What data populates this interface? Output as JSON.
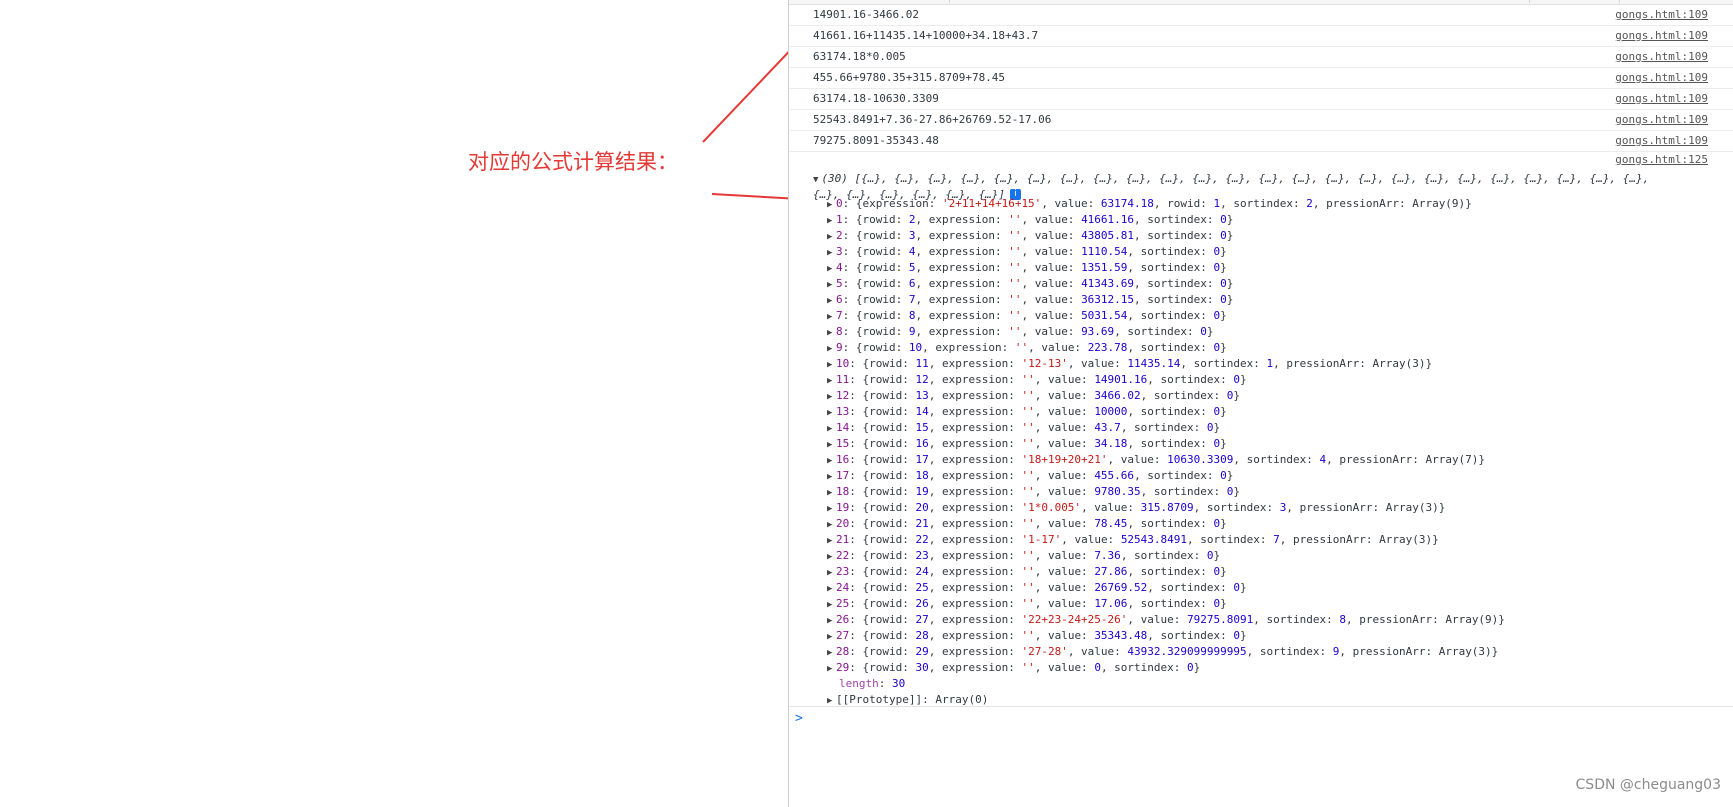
{
  "annotation": {
    "text": "对应的公式计算结果：",
    "color": "#e53935"
  },
  "log_lines": [
    {
      "text": "14901.16-3466.02",
      "source": "gongs.html:109"
    },
    {
      "text": "41661.16+11435.14+10000+34.18+43.7",
      "source": "gongs.html:109"
    },
    {
      "text": "63174.18*0.005",
      "source": "gongs.html:109"
    },
    {
      "text": "455.66+9780.35+315.8709+78.45",
      "source": "gongs.html:109"
    },
    {
      "text": "63174.18-10630.3309",
      "source": "gongs.html:109"
    },
    {
      "text": "52543.8491+7.36-27.86+26769.52-17.06",
      "source": "gongs.html:109"
    },
    {
      "text": "79275.8091-35343.48",
      "source": "gongs.html:109"
    }
  ],
  "group_source": "gongs.html:125",
  "array_header": "(30) [{…}, {…}, {…}, {…}, {…}, {…}, {…}, {…}, {…}, {…}, {…}, {…}, {…}, {…}, {…}, {…}, {…}, {…}, {…}, {…}, {…}, {…}, {…}, {…}, {…}, {…}, {…}, {…}, {…}, {…}]",
  "info_badge": "i",
  "entries": [
    {
      "index": "0",
      "text": "{expression: '2+11+14+16+15', value: 63174.18, rowid: 1, sortindex: 2, pressionArr: Array(9)}"
    },
    {
      "index": "1",
      "text": "{rowid: 2, expression: '', value: 41661.16, sortindex: 0}"
    },
    {
      "index": "2",
      "text": "{rowid: 3, expression: '', value: 43805.81, sortindex: 0}"
    },
    {
      "index": "3",
      "text": "{rowid: 4, expression: '', value: 1110.54, sortindex: 0}"
    },
    {
      "index": "4",
      "text": "{rowid: 5, expression: '', value: 1351.59, sortindex: 0}"
    },
    {
      "index": "5",
      "text": "{rowid: 6, expression: '', value: 41343.69, sortindex: 0}"
    },
    {
      "index": "6",
      "text": "{rowid: 7, expression: '', value: 36312.15, sortindex: 0}"
    },
    {
      "index": "7",
      "text": "{rowid: 8, expression: '', value: 5031.54, sortindex: 0}"
    },
    {
      "index": "8",
      "text": "{rowid: 9, expression: '', value: 93.69, sortindex: 0}"
    },
    {
      "index": "9",
      "text": "{rowid: 10, expression: '', value: 223.78, sortindex: 0}"
    },
    {
      "index": "10",
      "text": "{rowid: 11, expression: '12-13', value: 11435.14, sortindex: 1, pressionArr: Array(3)}"
    },
    {
      "index": "11",
      "text": "{rowid: 12, expression: '', value: 14901.16, sortindex: 0}"
    },
    {
      "index": "12",
      "text": "{rowid: 13, expression: '', value: 3466.02, sortindex: 0}"
    },
    {
      "index": "13",
      "text": "{rowid: 14, expression: '', value: 10000, sortindex: 0}"
    },
    {
      "index": "14",
      "text": "{rowid: 15, expression: '', value: 43.7, sortindex: 0}"
    },
    {
      "index": "15",
      "text": "{rowid: 16, expression: '', value: 34.18, sortindex: 0}"
    },
    {
      "index": "16",
      "text": "{rowid: 17, expression: '18+19+20+21', value: 10630.3309, sortindex: 4, pressionArr: Array(7)}"
    },
    {
      "index": "17",
      "text": "{rowid: 18, expression: '', value: 455.66, sortindex: 0}"
    },
    {
      "index": "18",
      "text": "{rowid: 19, expression: '', value: 9780.35, sortindex: 0}"
    },
    {
      "index": "19",
      "text": "{rowid: 20, expression: '1*0.005', value: 315.8709, sortindex: 3, pressionArr: Array(3)}"
    },
    {
      "index": "20",
      "text": "{rowid: 21, expression: '', value: 78.45, sortindex: 0}"
    },
    {
      "index": "21",
      "text": "{rowid: 22, expression: '1-17', value: 52543.8491, sortindex: 7, pressionArr: Array(3)}"
    },
    {
      "index": "22",
      "text": "{rowid: 23, expression: '', value: 7.36, sortindex: 0}"
    },
    {
      "index": "23",
      "text": "{rowid: 24, expression: '', value: 27.86, sortindex: 0}"
    },
    {
      "index": "24",
      "text": "{rowid: 25, expression: '', value: 26769.52, sortindex: 0}"
    },
    {
      "index": "25",
      "text": "{rowid: 26, expression: '', value: 17.06, sortindex: 0}"
    },
    {
      "index": "26",
      "text": "{rowid: 27, expression: '22+23-24+25-26', value: 79275.8091, sortindex: 8, pressionArr: Array(9)}"
    },
    {
      "index": "27",
      "text": "{rowid: 28, expression: '', value: 35343.48, sortindex: 0}"
    },
    {
      "index": "28",
      "text": "{rowid: 29, expression: '27-28', value: 43932.329099999995, sortindex: 9, pressionArr: Array(3)}"
    },
    {
      "index": "29",
      "text": "{rowid: 30, expression: '', value: 0, sortindex: 0}"
    }
  ],
  "length_key": "length",
  "length_value": "30",
  "prototype_text": "[[Prototype]]: Array(0)",
  "prompt_symbol": ">",
  "watermark": "CSDN @cheguang03",
  "icons": {
    "expand": "triangle-right-icon",
    "collapse": "triangle-down-icon",
    "info": "info-icon"
  }
}
